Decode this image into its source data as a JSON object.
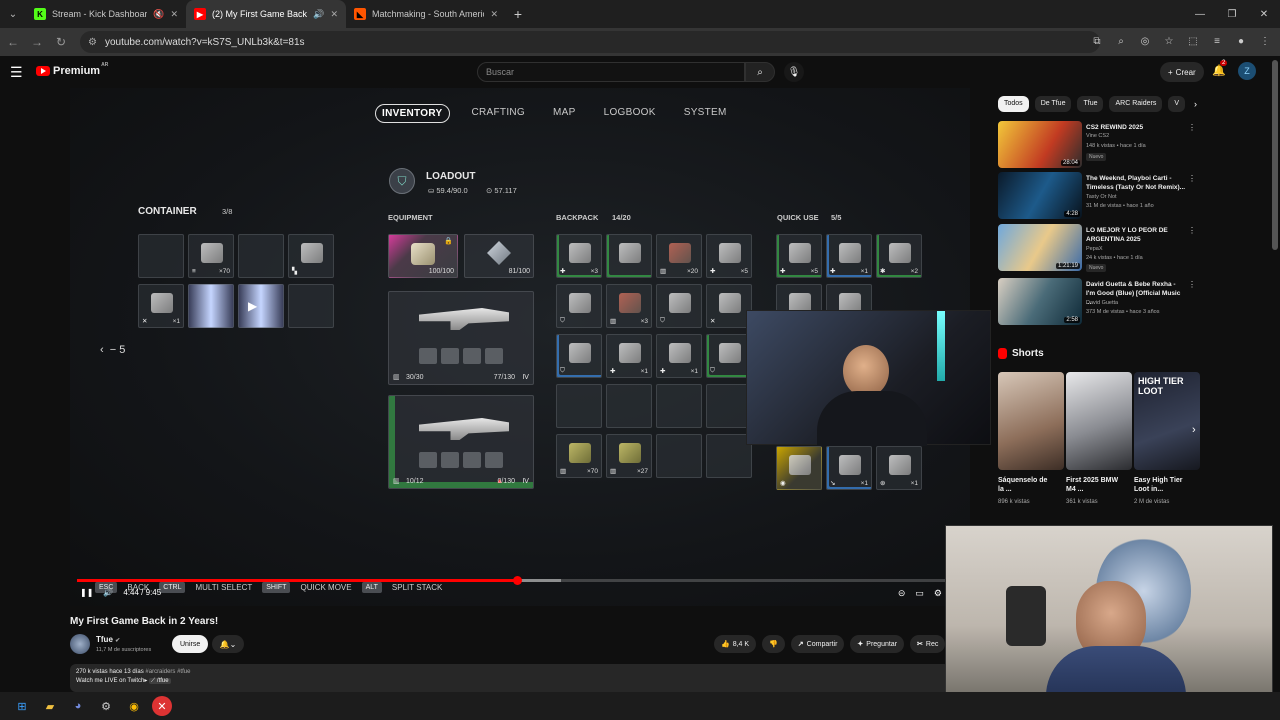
{
  "browser": {
    "tabs": [
      {
        "title": "Stream - Kick Dashboard",
        "icon": "kick-icon",
        "active": false
      },
      {
        "title": "(2) My First Game Back in 2",
        "icon": "youtube-icon",
        "active": true
      },
      {
        "title": "Matchmaking - South America",
        "icon": "faceit-icon",
        "active": false
      }
    ],
    "url": "youtube.com/watch?v=kS7S_UNLb3k&t=81s"
  },
  "youtube": {
    "logo": "Premium",
    "logo_sup": "AR",
    "search_placeholder": "Buscar",
    "create_label": "Crear",
    "notif_count": "2",
    "avatar_letter": "Z"
  },
  "game": {
    "nav": [
      "INVENTORY",
      "CRAFTING",
      "MAP",
      "LOGBOOK",
      "SYSTEM"
    ],
    "nav_selected": "INVENTORY",
    "loadout_title": "LOADOUT",
    "weight": "59.4/90.0",
    "currency": "57.117",
    "container_title": "CONTAINER",
    "container_count": "3/8",
    "equipment_title": "EQUIPMENT",
    "backpack_title": "BACKPACK",
    "backpack_count": "14/20",
    "quickuse_title": "QUICK USE",
    "quickuse_count": "5/5",
    "page_indicator": "5",
    "shield_value": "100/100",
    "augment_value": "81/100",
    "weapon1_ammo": "30/30",
    "weapon1_reserve": "77/130",
    "weapon2_ammo": "10/12",
    "weapon2_reserve": "0/130",
    "container_counts": [
      "",
      "×70",
      "",
      "",
      "×1",
      "",
      "",
      ""
    ],
    "backpack_counts": [
      "×3",
      "",
      "×20",
      "×5",
      "",
      "×3",
      "",
      "",
      "×1",
      "×1",
      "",
      "",
      "",
      "",
      "",
      "",
      "×70",
      "×27",
      "",
      ""
    ],
    "quick_counts": [
      "×5",
      "×1",
      "×2",
      "",
      "",
      "",
      "×1",
      "×1"
    ],
    "keys": [
      {
        "key": "ESC",
        "label": "BACK"
      },
      {
        "key": "CTRL",
        "label": "MULTI SELECT"
      },
      {
        "key": "SHIFT",
        "label": "QUICK MOVE"
      },
      {
        "key": "ALT",
        "label": "SPLIT STACK"
      }
    ]
  },
  "player": {
    "time": "4:44 / 9:45",
    "progress": 0.5,
    "buffered": 0.55
  },
  "video": {
    "title": "My First Game Back in 2 Years!",
    "channel": "Tfue",
    "subscribers": "11,7 M de suscriptores",
    "join_label": "Unirse",
    "likes": "8,4 K",
    "share": "Compartir",
    "ask": "Preguntar",
    "more": "Rec",
    "desc_meta": "270 k vistas  hace 13 días",
    "desc_tags": "#arcraiders #tfue",
    "desc_line2": "Watch me LIVE on Twitch▸",
    "desc_link": "⟋ /tfue"
  },
  "sidebar": {
    "chips": [
      "Todos",
      "De Tfue",
      "Tfue",
      "ARC Raiders",
      "V"
    ],
    "recs": [
      {
        "title": "CS2 REWIND 2025",
        "channel": "Vine CS2",
        "meta": "148 k vistas • hace 1 día",
        "badge": "Nuevo",
        "dur": "28:04"
      },
      {
        "title": "The Weeknd, Playboi Carti - Timeless (Tasty Or Not Remix)...",
        "channel": "Tasty Or Not",
        "meta": "31 M de vistas • hace 1 año",
        "badge": "",
        "dur": "4:28"
      },
      {
        "title": "LO MEJOR Y LO PEOR DE ARGENTINA 2025",
        "channel": "PepaX",
        "meta": "24 k vistas • hace 1 día",
        "badge": "Nuevo",
        "dur": "1:21:19"
      },
      {
        "title": "David Guetta & Bebe Rexha - I'm Good (Blue) [Official Music ...",
        "channel": "David Guetta",
        "meta": "373 M de vistas • hace 3 años",
        "badge": "",
        "dur": "2:58"
      }
    ],
    "shorts_title": "Shorts",
    "shorts": [
      {
        "title": "Sáquenselo de la ...",
        "views": "896 k vistas"
      },
      {
        "title": "First 2025 BMW M4 ...",
        "views": "361 k vistas"
      },
      {
        "title": "Easy High Tier Loot in...",
        "views": "2 M de vistas",
        "overlay": "HIGH TIER LOOT"
      }
    ]
  }
}
